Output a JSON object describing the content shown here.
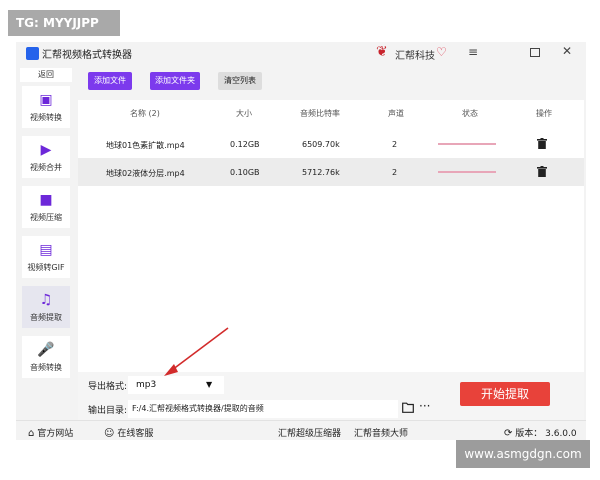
{
  "watermark": {
    "top_text": "TG: MYYJJPP",
    "bottom_text": "www.asmgdgn.com"
  },
  "window": {
    "title": "汇帮视频格式转换器",
    "brand": "汇帮科技",
    "icons": {
      "menu": "menu-icon",
      "maximize": "maximize-icon",
      "close": "close-icon"
    }
  },
  "sidebar": {
    "back_label": "返回",
    "items": [
      {
        "label": "视频转换",
        "icon": "video-convert-icon"
      },
      {
        "label": "视频合并",
        "icon": "video-merge-icon"
      },
      {
        "label": "视频压缩",
        "icon": "video-compress-icon"
      },
      {
        "label": "视频转GIF",
        "icon": "gif-icon"
      },
      {
        "label": "音频提取",
        "icon": "music-icon",
        "active": true
      },
      {
        "label": "音频转换",
        "icon": "microphone-icon"
      }
    ]
  },
  "toolbar": {
    "add_file": "添加文件",
    "add_folder": "添加文件夹",
    "clear_list": "清空列表"
  },
  "table": {
    "headers": {
      "name": "名称 (2)",
      "size": "大小",
      "bitrate": "音频比特率",
      "channels": "声道",
      "status": "状态",
      "action": "操作"
    },
    "rows": [
      {
        "name": "地球01色素扩散.mp4",
        "size": "0.12GB",
        "bitrate": "6509.70k",
        "channels": "2"
      },
      {
        "name": "地球02液体分层.mp4",
        "size": "0.10GB",
        "bitrate": "5712.76k",
        "channels": "2"
      }
    ]
  },
  "output": {
    "format_label": "导出格式:",
    "format_value": "mp3",
    "dir_label": "输出目录:",
    "dir_value": "F:/4.汇帮视频格式转换器/提取的音频",
    "more": "···",
    "start_button": "开始提取"
  },
  "footer": {
    "official_site": "官方网站",
    "online_service": "在线客服",
    "compressor": "汇帮超级压缩器",
    "audio_master": "汇帮音频大师",
    "version": "版本： 3.6.0.0"
  },
  "colors": {
    "accent": "#7c3aed",
    "start": "#e8423a",
    "annotation_arrow": "#d22b2b"
  }
}
